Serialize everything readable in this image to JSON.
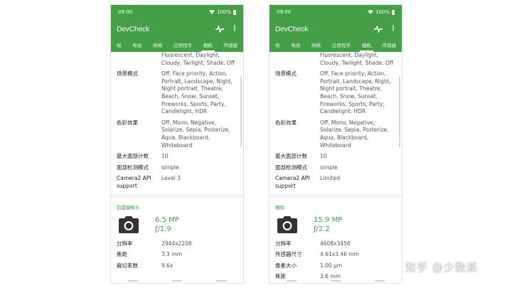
{
  "status_time": "09:00",
  "battery": "100%",
  "app_title": "DevCheck",
  "tabs": [
    "规",
    "电池",
    "网络",
    "应用程序",
    "相机",
    "传感器"
  ],
  "left": {
    "rows_top": [
      {
        "label": "",
        "lines": [
          "Fluorescent, Daylight,",
          "Cloudy, Twilight, Shade, Off"
        ]
      },
      {
        "label": "场景模式",
        "lines": [
          "Off, Face priority, Action,",
          "Portrait, Landscape, Night,",
          "Night portrait, Theatre,",
          "Beach, Snow, Sunset,",
          "Fireworks, Sports, Party,",
          "Candlelight, HDR"
        ]
      },
      {
        "label": "色彩效果",
        "lines": [
          "Off, Mono, Negative,",
          "Solarize, Sepia, Posterize,",
          "Aqua, Blackboard,",
          "Whiteboard"
        ]
      },
      {
        "label": "最大面部计数",
        "lines": [
          "10"
        ]
      },
      {
        "label": "面部检测模式",
        "lines": [
          "simple"
        ]
      },
      {
        "label": "Camera2 API support",
        "lines": [
          "Level 3"
        ]
      }
    ],
    "section_title": "前置摄像头",
    "mp": "6.5 MP",
    "aperture": "ƒ/1.9",
    "rows_bottom": [
      {
        "label": "分辨率",
        "lines": [
          "2944x2208"
        ]
      },
      {
        "label": "焦距",
        "lines": [
          "3.3 mm"
        ]
      },
      {
        "label": "裁切系数",
        "lines": [
          "9.6x"
        ]
      }
    ]
  },
  "right": {
    "rows_top": [
      {
        "label": "",
        "lines": [
          "Fluorescent, Daylight,",
          "Cloudy, Twilight, Shade, Off"
        ]
      },
      {
        "label": "场景模式",
        "lines": [
          "Off, Face priority, Action,",
          "Portrait, Landscape, Night,",
          "Night portrait, Theatre,",
          "Beach, Snow, Sunset,",
          "Fireworks, Sports, Party,",
          "Candlelight, HDR"
        ]
      },
      {
        "label": "色彩效果",
        "lines": [
          "Off, Mono, Negative,",
          "Solarize, Sepia, Posterize,",
          "Aqua, Blackboard,",
          "Whiteboard"
        ]
      },
      {
        "label": "最大面部计数",
        "lines": [
          "10"
        ]
      },
      {
        "label": "面部检测模式",
        "lines": [
          "simple"
        ]
      },
      {
        "label": "Camera2 API support",
        "lines": [
          "Limited"
        ]
      }
    ],
    "section_title": "相机",
    "mp": "15.9 MP",
    "aperture": "ƒ/2.2",
    "rows_bottom": [
      {
        "label": "分辨率",
        "lines": [
          "4608x3456"
        ]
      },
      {
        "label": "传感器尺寸",
        "lines": [
          "4.61x3.46 mm"
        ]
      },
      {
        "label": "像素大小",
        "lines": [
          "1.00 μm"
        ]
      },
      {
        "label": "焦距",
        "lines": [
          "3.6 mm"
        ]
      }
    ]
  },
  "watermark": "知乎 @少数派",
  "colors": {
    "accent": "#43a047",
    "text": "#333333"
  }
}
